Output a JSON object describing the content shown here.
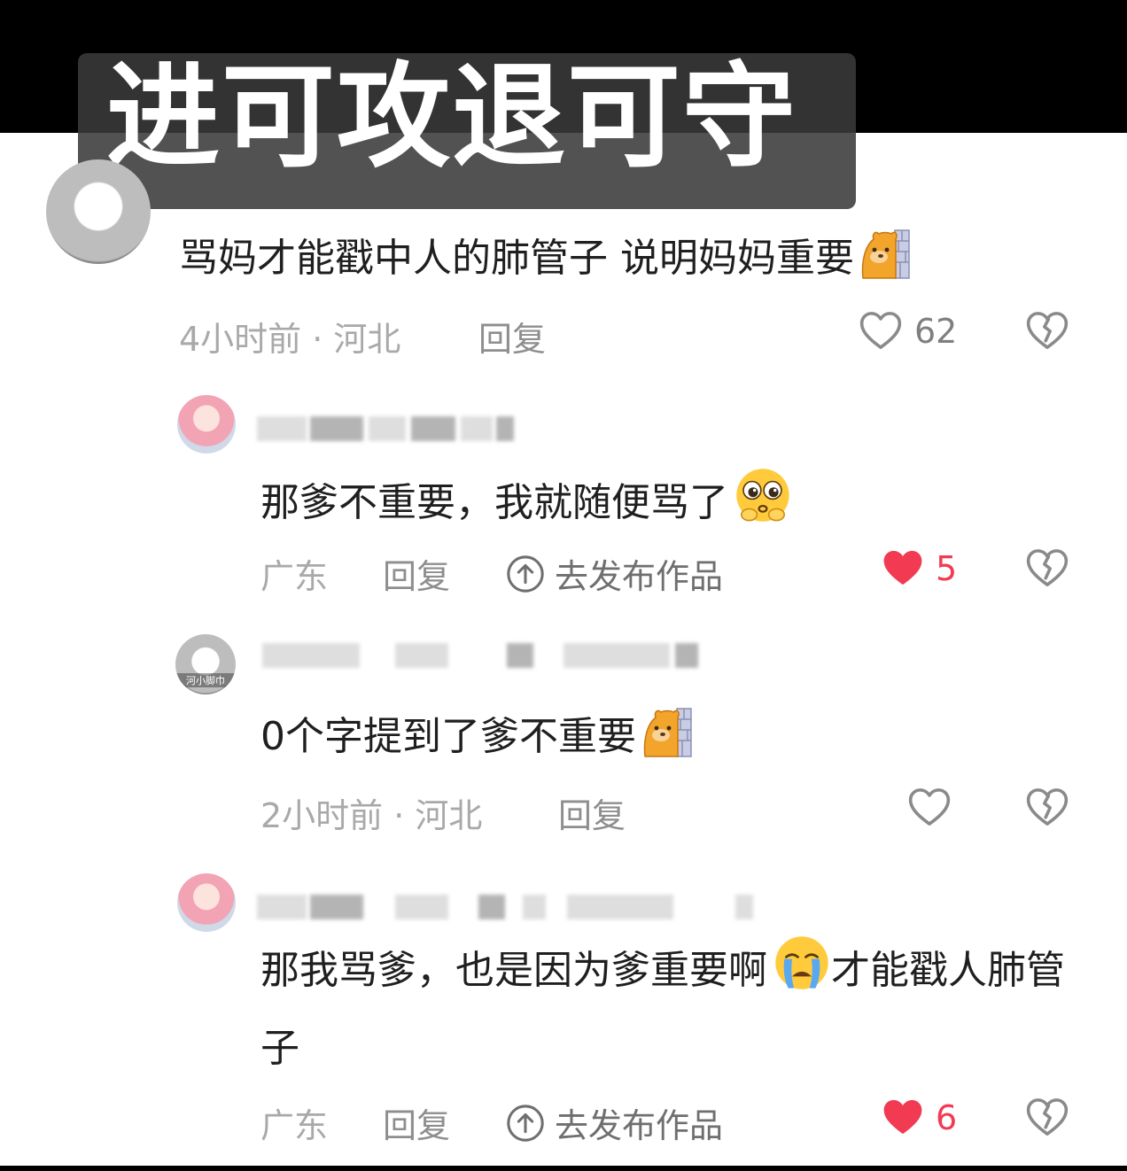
{
  "overlay": {
    "title": "进可攻退可守"
  },
  "colors": {
    "liked": "#f23a52",
    "meta": "#a9a9a9",
    "text": "#1f1f1f"
  },
  "comments": [
    {
      "text": "骂妈才能戳中人的肺管子 说明妈妈重要",
      "emoji": "bear-peek-icon",
      "time": "4小时前 · 河北",
      "reply": "回复",
      "likes": "62",
      "liked": false
    },
    {
      "text": "那爹不重要，我就随便骂了",
      "emoji": "pleading-face-icon",
      "location": "广东",
      "reply": "回复",
      "publish": "去发布作品",
      "likes": "5",
      "liked": true
    },
    {
      "avatar_badge": "河小脚巾",
      "text": "0个字提到了爹不重要",
      "emoji": "bear-peek-icon",
      "time": "2小时前 · 河北",
      "reply": "回复",
      "liked": false
    },
    {
      "text_before": "那我骂爹，也是因为爹重要啊",
      "emoji": "crying-face-icon",
      "text_after": "才能戳人肺管子",
      "location": "广东",
      "reply": "回复",
      "publish": "去发布作品",
      "likes": "6",
      "liked": true
    }
  ]
}
